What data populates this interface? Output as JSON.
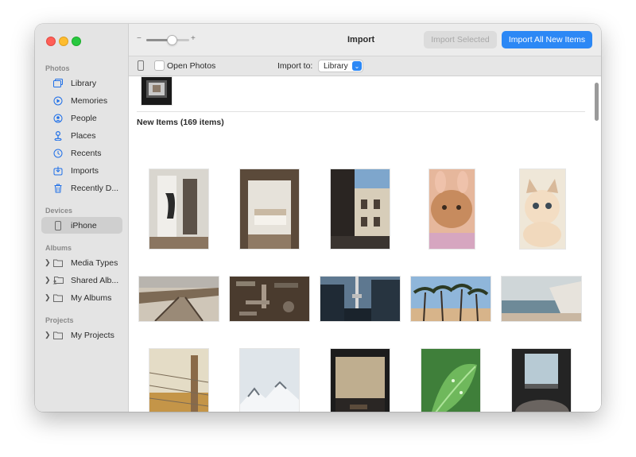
{
  "window": {
    "title": "Import",
    "toolbar": {
      "import_selected_label": "Import Selected",
      "import_all_label": "Import All New Items",
      "zoom_minus": "−",
      "zoom_plus": "+",
      "zoom_level": 0.6
    },
    "subbar": {
      "open_photos_label": "Open Photos",
      "open_photos_checked": false,
      "import_to_label": "Import to:",
      "import_to_value": "Library"
    }
  },
  "sidebar": {
    "sections": [
      {
        "title": "Photos",
        "items": [
          {
            "label": "Library",
            "icon": "library-icon"
          },
          {
            "label": "Memories",
            "icon": "memories-icon"
          },
          {
            "label": "People",
            "icon": "people-icon"
          },
          {
            "label": "Places",
            "icon": "places-icon"
          },
          {
            "label": "Recents",
            "icon": "recents-icon"
          },
          {
            "label": "Imports",
            "icon": "imports-icon"
          },
          {
            "label": "Recently D...",
            "icon": "trash-icon"
          }
        ]
      },
      {
        "title": "Devices",
        "items": [
          {
            "label": "iPhone",
            "icon": "iphone-icon",
            "selected": true
          }
        ]
      },
      {
        "title": "Albums",
        "items": [
          {
            "label": "Media Types",
            "icon": "folder-icon"
          },
          {
            "label": "Shared Alb...",
            "icon": "shared-albums-icon"
          },
          {
            "label": "My Albums",
            "icon": "folder-icon"
          }
        ]
      },
      {
        "title": "Projects",
        "items": [
          {
            "label": "My Projects",
            "icon": "folder-icon"
          }
        ]
      }
    ]
  },
  "content": {
    "section_heading": "New Items (169 items)"
  },
  "colors": {
    "accent": "#2c88f5",
    "close": "#ff5f57",
    "minimize": "#febc2e",
    "zoom": "#28c840",
    "sidebar_bg": "#e4e4e4"
  }
}
